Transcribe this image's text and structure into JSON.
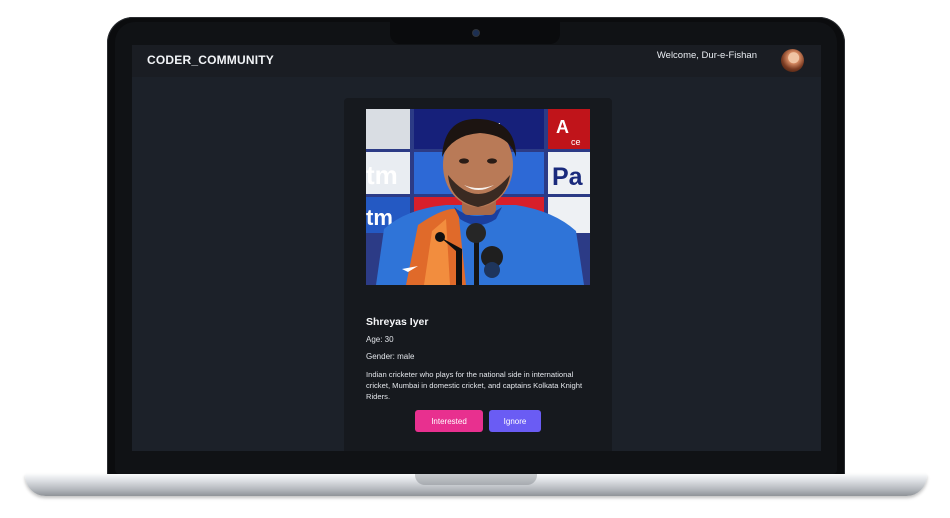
{
  "navbar": {
    "brand": "CODER_COMMUNITY",
    "welcome_text": "Welcome, Dur-e-Fishan"
  },
  "profile_card": {
    "name": "Shreyas Iyer",
    "age": "Age: 30",
    "gender": "Gender: male",
    "bio": "Indian cricketer who plays for the national side in international cricket, Mumbai in domestic cricket, and captains Kolkata Knight Riders.",
    "photo_sponsor_text": {
      "pepsi": "epsi",
      "tm_top": "tm",
      "tm_right": "tm",
      "pa": "Pa",
      "a": "A",
      "ce": "ce",
      "tm_bottom": "tm"
    }
  },
  "actions": {
    "interested_label": "Interested",
    "ignore_label": "Ignore"
  },
  "colors": {
    "interested": "#e8308f",
    "ignore": "#6a5cf4",
    "navbar": "#1a1d23",
    "screen": "#1c2129",
    "card": "#16191e"
  }
}
